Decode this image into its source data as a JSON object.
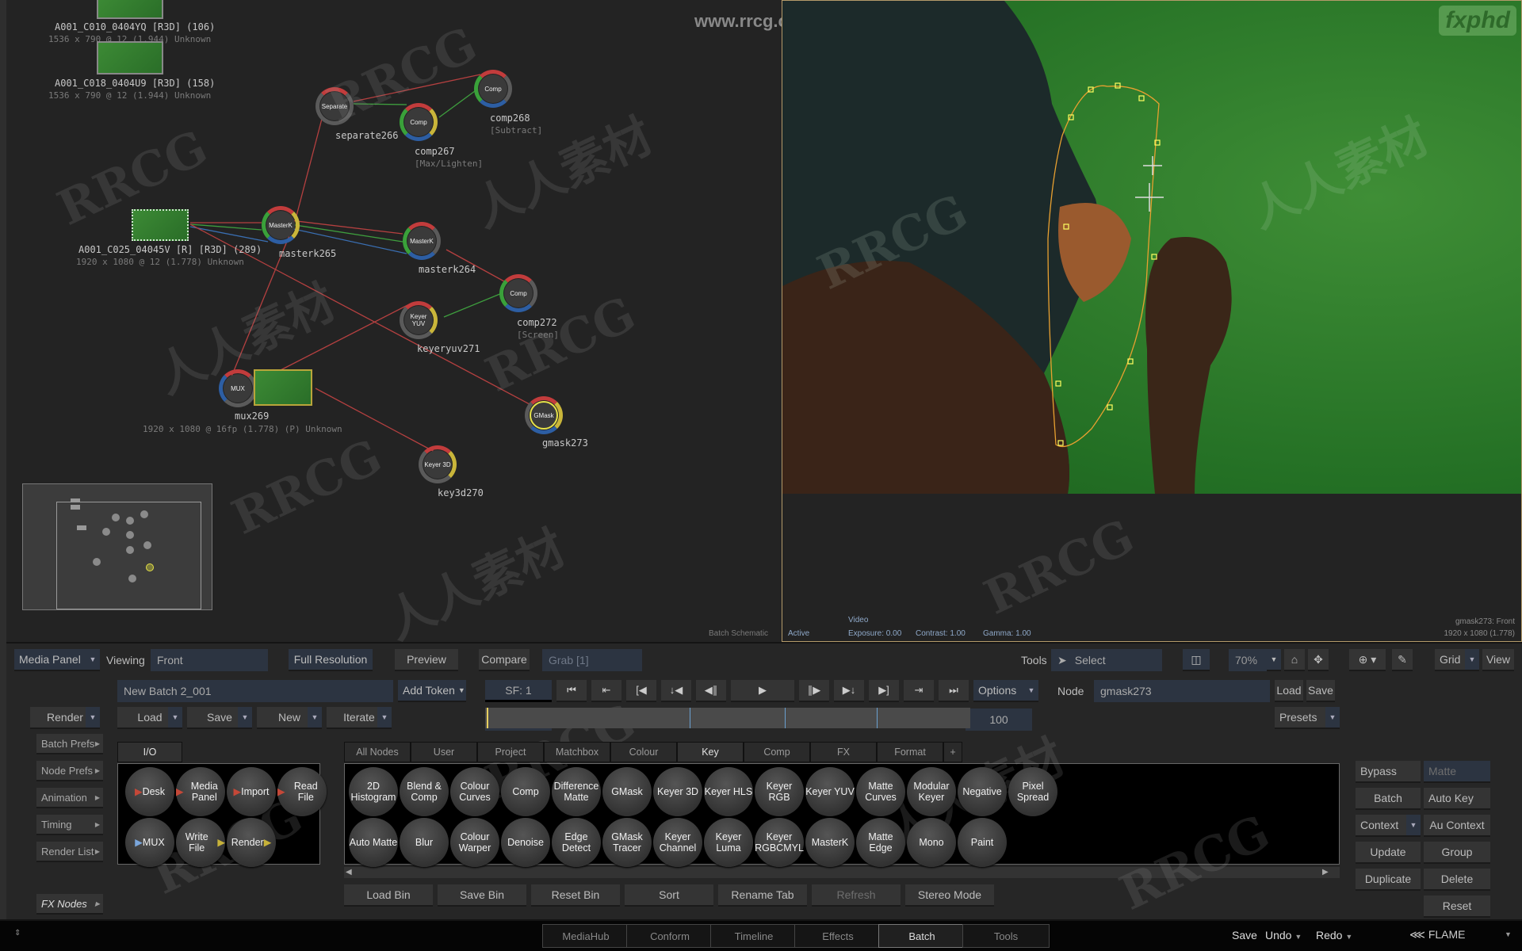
{
  "schematic": {
    "nodes": [
      {
        "id": "clip1",
        "label": "A001_C010_0404YQ [R3D] (106)",
        "sub": "1536 x 790 @ 12 (1.944)  Unknown"
      },
      {
        "id": "clip2",
        "label": "A001_C018_0404U9 [R3D] (158)",
        "sub": "1536 x 790 @ 12 (1.944)  Unknown"
      },
      {
        "id": "clip3",
        "label": "A001_C025_04045V [R] [R3D] (289)",
        "sub": "1920 x 1080 @ 12 (1.778)  Unknown"
      },
      {
        "id": "separate266",
        "core": "Separate",
        "label": "separate266"
      },
      {
        "id": "comp267",
        "core": "Comp",
        "label": "comp267",
        "sub": "[Max/Lighten]"
      },
      {
        "id": "comp268",
        "core": "Comp",
        "label": "comp268",
        "sub": "[Subtract]"
      },
      {
        "id": "masterk265",
        "core": "MasterK",
        "label": "masterk265"
      },
      {
        "id": "masterk264",
        "core": "MasterK",
        "label": "masterk264"
      },
      {
        "id": "comp272",
        "core": "Comp",
        "label": "comp272",
        "sub": "[Screen]"
      },
      {
        "id": "keyeryuv271",
        "core": "Keyer YUV",
        "label": "keyeryuv271"
      },
      {
        "id": "mux269",
        "core": "MUX",
        "label": "mux269",
        "sub": "1920 x 1080 @ 16fp (1.778) (P) Unknown"
      },
      {
        "id": "gmask273",
        "core": "GMask",
        "label": "gmask273"
      },
      {
        "id": "key3d270",
        "core": "Keyer 3D",
        "label": "key3d270"
      }
    ]
  },
  "viewer": {
    "watermark_logo": "fxphd",
    "site_watermark": "www.rrcg.cn",
    "mode": "Video",
    "left_label": "Batch Schematic",
    "state": "Active",
    "exposure": "Exposure: 0.00",
    "contrast": "Contrast: 1.00",
    "gamma": "Gamma: 1.00",
    "node_view": "gmask273: Front",
    "resolution": "1920 x 1080 (1.778)"
  },
  "toolbar": {
    "media_panel": "Media Panel",
    "viewing_label": "Viewing",
    "viewing_value": "Front",
    "full_resolution": "Full Resolution",
    "preview": "Preview",
    "compare": "Compare",
    "grab": "Grab [1]",
    "tools_label": "Tools",
    "tool_select": "Select",
    "zoom": "70%",
    "grid": "Grid",
    "view": "View"
  },
  "batch": {
    "name": "New Batch 2_001",
    "add_token": "Add Token",
    "render": "Render",
    "load": "Load",
    "save": "Save",
    "new": "New",
    "iterate": "Iterate",
    "sf": "SF: 1",
    "start_frame": "1",
    "end_frame": "100",
    "options": "Options",
    "node_label": "Node",
    "node_value": "gmask273",
    "node_load": "Load",
    "node_save": "Save",
    "presets": "Presets",
    "playhead_fraction": 0.0
  },
  "side_menu": [
    "Batch Prefs",
    "Node Prefs",
    "Animation",
    "Timing",
    "Render List"
  ],
  "fx_nodes": "FX Nodes",
  "io_tab": "I/O",
  "io_nodes": [
    {
      "label": "Desk",
      "arrow": "red-left"
    },
    {
      "label": "Media Panel",
      "arrow": "red-left"
    },
    {
      "label": "Import",
      "arrow": "red-left"
    },
    {
      "label": "Read File",
      "arrow": "red-left"
    },
    {
      "label": "MUX",
      "arrow": "blue"
    },
    {
      "label": "Write File",
      "arrow": "yellow-right"
    },
    {
      "label": "Render",
      "arrow": "yellow-right"
    }
  ],
  "bin_tabs": [
    "All Nodes",
    "User",
    "Project",
    "Matchbox",
    "Colour",
    "Key",
    "Comp",
    "FX",
    "Format",
    "+"
  ],
  "bin_active_tab": "Key",
  "bin_row1": [
    "2D Histogram",
    "Blend & Comp",
    "Colour Curves",
    "Comp",
    "Difference Matte",
    "GMask",
    "Keyer 3D",
    "Keyer HLS",
    "Keyer RGB",
    "Keyer YUV",
    "Matte Curves",
    "Modular Keyer",
    "Negative",
    "Pixel Spread"
  ],
  "bin_row2": [
    "Auto Matte",
    "Blur",
    "Colour Warper",
    "Denoise",
    "Edge Detect",
    "GMask Tracer",
    "Keyer Channel",
    "Keyer Luma",
    "Keyer RGBCMYL",
    "MasterK",
    "Matte Edge",
    "Mono",
    "Paint"
  ],
  "bin_buttons": [
    "Load Bin",
    "Save Bin",
    "Reset Bin",
    "Sort",
    "Rename Tab",
    "Refresh",
    "Stereo Mode"
  ],
  "right_panel": {
    "bypass": "Bypass",
    "matte": "Matte",
    "batch": "Batch",
    "auto_key": "Auto Key",
    "context": "Context",
    "au_context": "Au Context",
    "update": "Update",
    "group": "Group",
    "duplicate": "Duplicate",
    "delete": "Delete",
    "reset": "Reset"
  },
  "bottom_tabs": [
    "MediaHub",
    "Conform",
    "Timeline",
    "Effects",
    "Batch",
    "Tools"
  ],
  "bottom_active": "Batch",
  "bottom_right": {
    "save": "Save",
    "undo": "Undo",
    "redo": "Redo",
    "app": "FLAME"
  },
  "watermarks": [
    "RRCG",
    "人人素材"
  ]
}
